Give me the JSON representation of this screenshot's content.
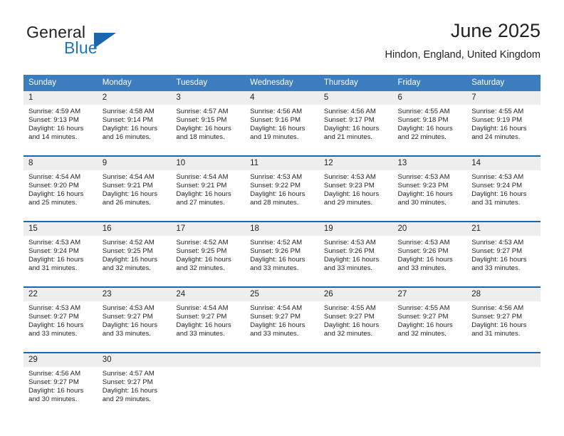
{
  "brand": {
    "name_part1": "General",
    "name_part2": "Blue",
    "logo_icon": "triangle-logo-icon",
    "accent_color": "#1b75bb"
  },
  "header": {
    "title": "June 2025",
    "location": "Hindon, England, United Kingdom"
  },
  "colors": {
    "header_row_bg": "#3c7dbf",
    "daynum_bg": "#eeeeee",
    "separator": "#1b66ad",
    "text": "#231f20"
  },
  "weekday_headers": [
    "Sunday",
    "Monday",
    "Tuesday",
    "Wednesday",
    "Thursday",
    "Friday",
    "Saturday"
  ],
  "weeks": [
    [
      {
        "day": "1",
        "sunrise": "Sunrise: 4:59 AM",
        "sunset": "Sunset: 9:13 PM",
        "daylight_line1": "Daylight: 16 hours",
        "daylight_line2": "and 14 minutes."
      },
      {
        "day": "2",
        "sunrise": "Sunrise: 4:58 AM",
        "sunset": "Sunset: 9:14 PM",
        "daylight_line1": "Daylight: 16 hours",
        "daylight_line2": "and 16 minutes."
      },
      {
        "day": "3",
        "sunrise": "Sunrise: 4:57 AM",
        "sunset": "Sunset: 9:15 PM",
        "daylight_line1": "Daylight: 16 hours",
        "daylight_line2": "and 18 minutes."
      },
      {
        "day": "4",
        "sunrise": "Sunrise: 4:56 AM",
        "sunset": "Sunset: 9:16 PM",
        "daylight_line1": "Daylight: 16 hours",
        "daylight_line2": "and 19 minutes."
      },
      {
        "day": "5",
        "sunrise": "Sunrise: 4:56 AM",
        "sunset": "Sunset: 9:17 PM",
        "daylight_line1": "Daylight: 16 hours",
        "daylight_line2": "and 21 minutes."
      },
      {
        "day": "6",
        "sunrise": "Sunrise: 4:55 AM",
        "sunset": "Sunset: 9:18 PM",
        "daylight_line1": "Daylight: 16 hours",
        "daylight_line2": "and 22 minutes."
      },
      {
        "day": "7",
        "sunrise": "Sunrise: 4:55 AM",
        "sunset": "Sunset: 9:19 PM",
        "daylight_line1": "Daylight: 16 hours",
        "daylight_line2": "and 24 minutes."
      }
    ],
    [
      {
        "day": "8",
        "sunrise": "Sunrise: 4:54 AM",
        "sunset": "Sunset: 9:20 PM",
        "daylight_line1": "Daylight: 16 hours",
        "daylight_line2": "and 25 minutes."
      },
      {
        "day": "9",
        "sunrise": "Sunrise: 4:54 AM",
        "sunset": "Sunset: 9:21 PM",
        "daylight_line1": "Daylight: 16 hours",
        "daylight_line2": "and 26 minutes."
      },
      {
        "day": "10",
        "sunrise": "Sunrise: 4:54 AM",
        "sunset": "Sunset: 9:21 PM",
        "daylight_line1": "Daylight: 16 hours",
        "daylight_line2": "and 27 minutes."
      },
      {
        "day": "11",
        "sunrise": "Sunrise: 4:53 AM",
        "sunset": "Sunset: 9:22 PM",
        "daylight_line1": "Daylight: 16 hours",
        "daylight_line2": "and 28 minutes."
      },
      {
        "day": "12",
        "sunrise": "Sunrise: 4:53 AM",
        "sunset": "Sunset: 9:23 PM",
        "daylight_line1": "Daylight: 16 hours",
        "daylight_line2": "and 29 minutes."
      },
      {
        "day": "13",
        "sunrise": "Sunrise: 4:53 AM",
        "sunset": "Sunset: 9:23 PM",
        "daylight_line1": "Daylight: 16 hours",
        "daylight_line2": "and 30 minutes."
      },
      {
        "day": "14",
        "sunrise": "Sunrise: 4:53 AM",
        "sunset": "Sunset: 9:24 PM",
        "daylight_line1": "Daylight: 16 hours",
        "daylight_line2": "and 31 minutes."
      }
    ],
    [
      {
        "day": "15",
        "sunrise": "Sunrise: 4:53 AM",
        "sunset": "Sunset: 9:24 PM",
        "daylight_line1": "Daylight: 16 hours",
        "daylight_line2": "and 31 minutes."
      },
      {
        "day": "16",
        "sunrise": "Sunrise: 4:52 AM",
        "sunset": "Sunset: 9:25 PM",
        "daylight_line1": "Daylight: 16 hours",
        "daylight_line2": "and 32 minutes."
      },
      {
        "day": "17",
        "sunrise": "Sunrise: 4:52 AM",
        "sunset": "Sunset: 9:25 PM",
        "daylight_line1": "Daylight: 16 hours",
        "daylight_line2": "and 32 minutes."
      },
      {
        "day": "18",
        "sunrise": "Sunrise: 4:52 AM",
        "sunset": "Sunset: 9:26 PM",
        "daylight_line1": "Daylight: 16 hours",
        "daylight_line2": "and 33 minutes."
      },
      {
        "day": "19",
        "sunrise": "Sunrise: 4:53 AM",
        "sunset": "Sunset: 9:26 PM",
        "daylight_line1": "Daylight: 16 hours",
        "daylight_line2": "and 33 minutes."
      },
      {
        "day": "20",
        "sunrise": "Sunrise: 4:53 AM",
        "sunset": "Sunset: 9:26 PM",
        "daylight_line1": "Daylight: 16 hours",
        "daylight_line2": "and 33 minutes."
      },
      {
        "day": "21",
        "sunrise": "Sunrise: 4:53 AM",
        "sunset": "Sunset: 9:27 PM",
        "daylight_line1": "Daylight: 16 hours",
        "daylight_line2": "and 33 minutes."
      }
    ],
    [
      {
        "day": "22",
        "sunrise": "Sunrise: 4:53 AM",
        "sunset": "Sunset: 9:27 PM",
        "daylight_line1": "Daylight: 16 hours",
        "daylight_line2": "and 33 minutes."
      },
      {
        "day": "23",
        "sunrise": "Sunrise: 4:53 AM",
        "sunset": "Sunset: 9:27 PM",
        "daylight_line1": "Daylight: 16 hours",
        "daylight_line2": "and 33 minutes."
      },
      {
        "day": "24",
        "sunrise": "Sunrise: 4:54 AM",
        "sunset": "Sunset: 9:27 PM",
        "daylight_line1": "Daylight: 16 hours",
        "daylight_line2": "and 33 minutes."
      },
      {
        "day": "25",
        "sunrise": "Sunrise: 4:54 AM",
        "sunset": "Sunset: 9:27 PM",
        "daylight_line1": "Daylight: 16 hours",
        "daylight_line2": "and 33 minutes."
      },
      {
        "day": "26",
        "sunrise": "Sunrise: 4:55 AM",
        "sunset": "Sunset: 9:27 PM",
        "daylight_line1": "Daylight: 16 hours",
        "daylight_line2": "and 32 minutes."
      },
      {
        "day": "27",
        "sunrise": "Sunrise: 4:55 AM",
        "sunset": "Sunset: 9:27 PM",
        "daylight_line1": "Daylight: 16 hours",
        "daylight_line2": "and 32 minutes."
      },
      {
        "day": "28",
        "sunrise": "Sunrise: 4:56 AM",
        "sunset": "Sunset: 9:27 PM",
        "daylight_line1": "Daylight: 16 hours",
        "daylight_line2": "and 31 minutes."
      }
    ],
    [
      {
        "day": "29",
        "sunrise": "Sunrise: 4:56 AM",
        "sunset": "Sunset: 9:27 PM",
        "daylight_line1": "Daylight: 16 hours",
        "daylight_line2": "and 30 minutes."
      },
      {
        "day": "30",
        "sunrise": "Sunrise: 4:57 AM",
        "sunset": "Sunset: 9:27 PM",
        "daylight_line1": "Daylight: 16 hours",
        "daylight_line2": "and 29 minutes."
      },
      {
        "day": "",
        "sunrise": "",
        "sunset": "",
        "daylight_line1": "",
        "daylight_line2": ""
      },
      {
        "day": "",
        "sunrise": "",
        "sunset": "",
        "daylight_line1": "",
        "daylight_line2": ""
      },
      {
        "day": "",
        "sunrise": "",
        "sunset": "",
        "daylight_line1": "",
        "daylight_line2": ""
      },
      {
        "day": "",
        "sunrise": "",
        "sunset": "",
        "daylight_line1": "",
        "daylight_line2": ""
      },
      {
        "day": "",
        "sunrise": "",
        "sunset": "",
        "daylight_line1": "",
        "daylight_line2": ""
      }
    ]
  ]
}
